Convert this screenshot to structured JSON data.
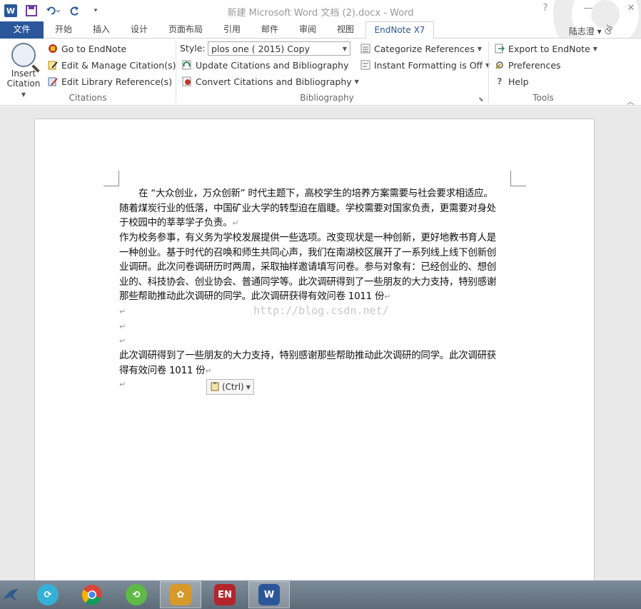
{
  "window": {
    "title": "新建 Microsoft Word 文档 (2).docx - Word",
    "controls": [
      "?",
      "□",
      "—",
      "□",
      "✕"
    ]
  },
  "qat": {
    "app_icon": "W"
  },
  "tabs": [
    "文件",
    "开始",
    "插入",
    "设计",
    "页面布局",
    "引用",
    "邮件",
    "审阅",
    "视图",
    "EndNote X7"
  ],
  "active_tab": "EndNote X7",
  "user": "陆志澄",
  "ribbon": {
    "citations": {
      "insert_label_1": "Insert",
      "insert_label_2": "Citation",
      "go_to": "Go to EndNote",
      "edit_manage": "Edit & Manage Citation(s)",
      "edit_library": "Edit Library Reference(s)",
      "group": "Citations"
    },
    "bibliography": {
      "style_label": "Style:",
      "style_value": "plos one ( 2015) Copy",
      "update": "Update Citations and Bibliography",
      "convert": "Convert Citations and Bibliography",
      "categorize": "Categorize References",
      "instant": "Instant Formatting is Off",
      "group": "Bibliography"
    },
    "tools": {
      "export": "Export to EndNote",
      "preferences": "Preferences",
      "help": "Help",
      "group": "Tools"
    }
  },
  "document": {
    "p1_l1": "在 “大众创业，万众创新” 时代主题下，高校学生的培养方案需要与社会要求相适应。",
    "p1_l2": "随着煤炭行业的低落，中国矿业大学的转型迫在眉睫。学校需要对国家负责，更需要对身处",
    "p1_l3": "于校园中的莘莘学子负责。",
    "p2_l1": "作为校务参事，有义务为学校发展提供一些选项。改变现状是一种创新，更好地教书育人是",
    "p2_l2": "一种创业。基于时代的召唤和师生共同心声，我们在南湖校区展开了一系列线上线下创新创",
    "p2_l3": "业调研。此次问卷调研历时两周，采取抽样邀请填写问卷。参与对象有：已经创业的、想创",
    "p2_l4": "业的、科技协会、创业协会、普通同学等。此次调研得到了一些朋友的大力支持，特别感谢",
    "p2_l5": "那些帮助推动此次调研的同学。此次调研获得有效问卷 1011 份",
    "p3_l1": "此次调研得到了一些朋友的大力支持，特别感谢那些帮助推动此次调研的同学。此次调研获",
    "p3_l2": "得有效问卷 1011 份",
    "watermark": "http://blog.csdn.net/",
    "paste_options": "(Ctrl)",
    "para_mark": "↵"
  },
  "colors": {
    "accent": "#2b579a"
  }
}
